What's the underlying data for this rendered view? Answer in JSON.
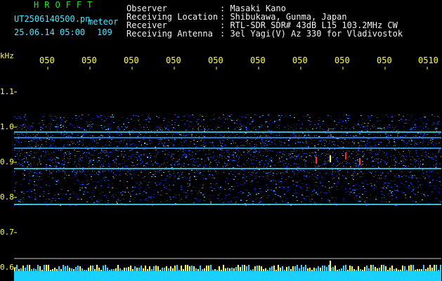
{
  "header": {
    "title": "HROFFT",
    "filename": "UT2506140500.pn",
    "meteor_label": "meteor",
    "timestamp": "25.06.14 05:00",
    "meteor_count": "109"
  },
  "info": {
    "observer_key": "Observer",
    "observer_val": ": Masaki Kano",
    "location_key": "Receiving Location",
    "location_val": ": Shibukawa, Gunma, Japan",
    "receiver_key": "Receiver",
    "receiver_val": ": RTL-SDR SDR# 43dB L15 103.2MHz CW",
    "antenna_key": "Receiving Antenna",
    "antenna_val": ": 3el Yagi(V) Az 330 for Vladivostok"
  },
  "axis": {
    "unit": "kHz",
    "y_ticks": [
      "1.1",
      "1.0",
      "0.9",
      "0.8",
      "0.7",
      "0.6"
    ],
    "x_ticks": [
      "050",
      "050",
      "050",
      "050",
      "050",
      "050",
      "050",
      "050",
      "050",
      "0510"
    ]
  },
  "colors": {
    "background": "#000000",
    "text_green": "#27e427",
    "text_cyan": "#4be7ff",
    "text_white": "#f2f2f2",
    "axis_yellow": "#ffff44",
    "noise_blue": "#1030c8",
    "echo_line": "#40e0ff"
  }
}
